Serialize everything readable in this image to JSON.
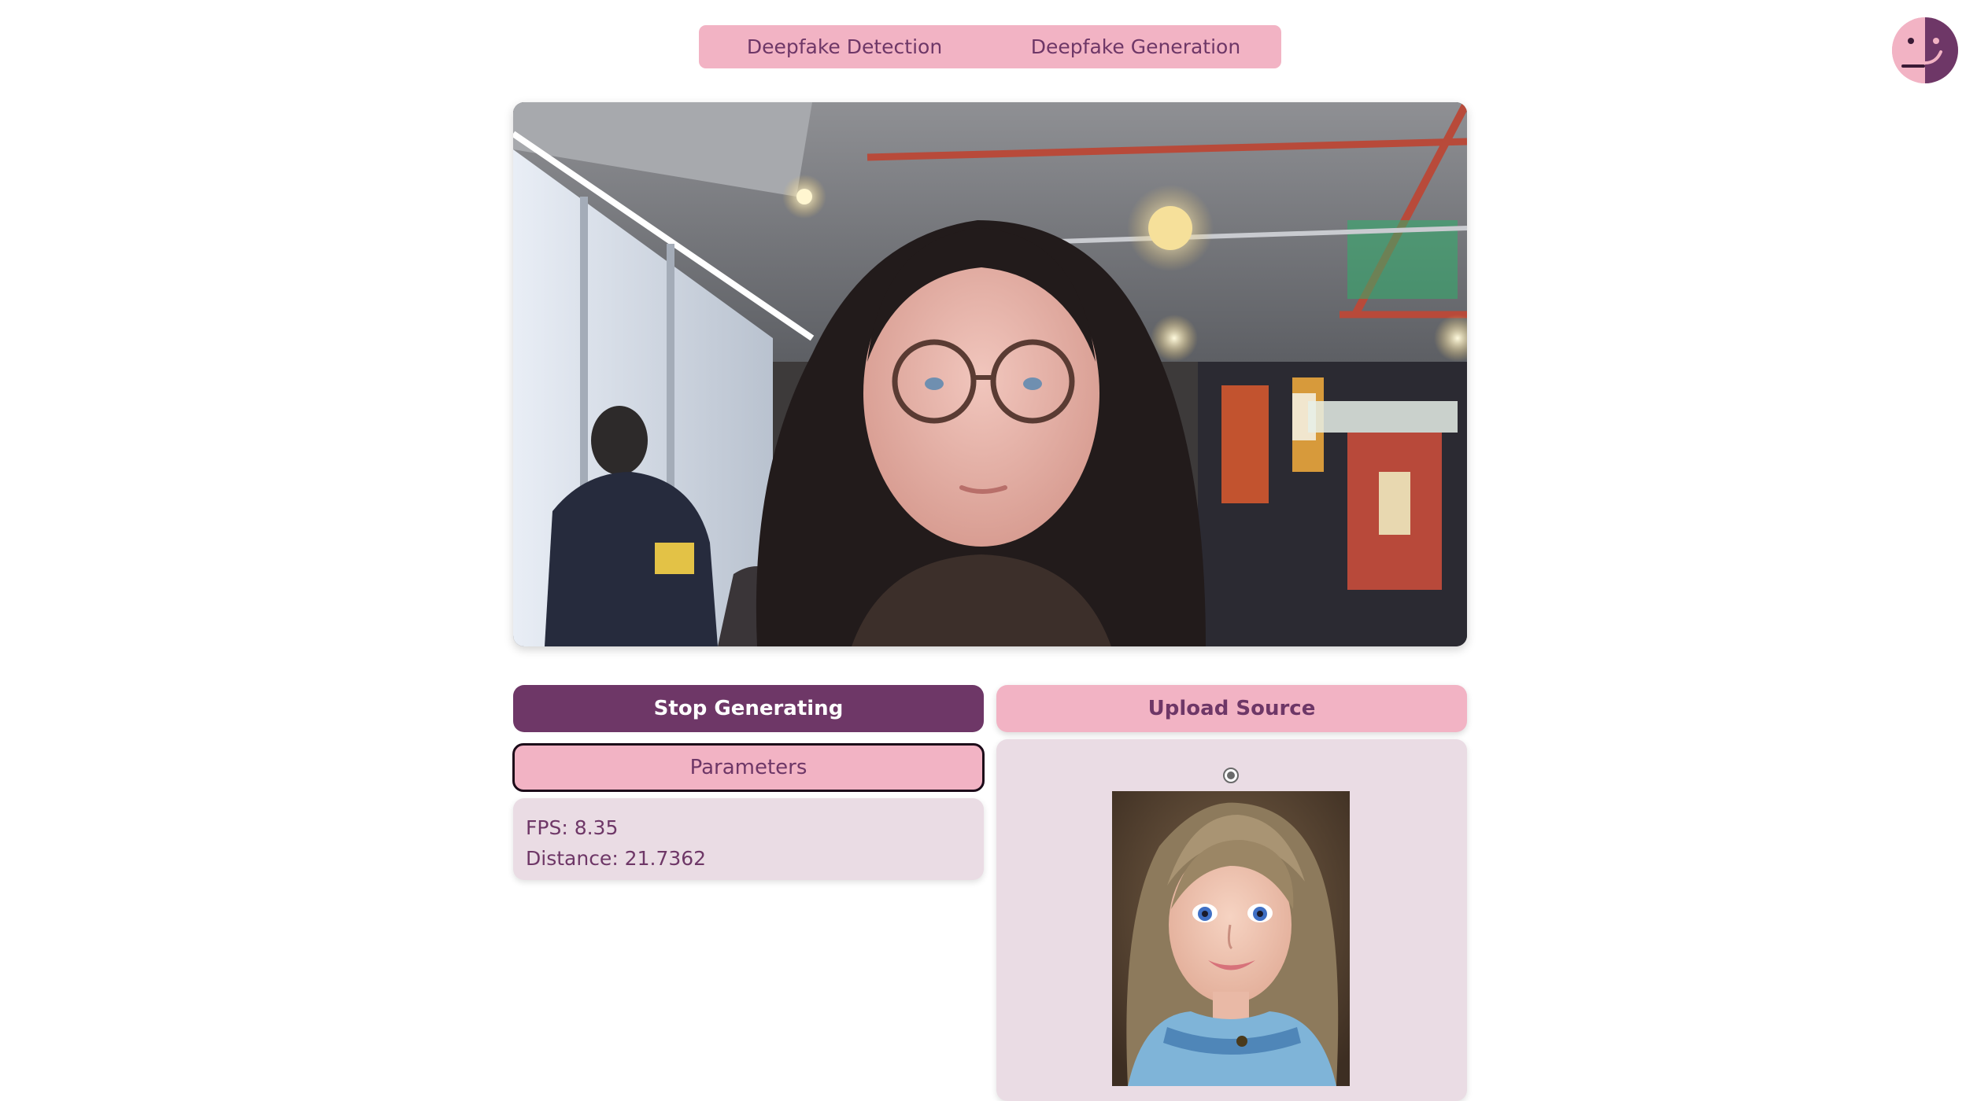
{
  "tabs": [
    {
      "label": "Deepfake Detection"
    },
    {
      "label": "Deepfake Generation"
    }
  ],
  "buttons": {
    "stop_label": "Stop Generating",
    "upload_label": "Upload Source",
    "parameters_label": "Parameters"
  },
  "stats": {
    "fps": "FPS: 8.35",
    "distance": "Distance: 21.7362"
  },
  "source": {
    "selected": true
  },
  "colors": {
    "accent_dark": "#6e3767",
    "accent_pink": "#f2b3c4",
    "panel_bg": "#eadce4"
  }
}
